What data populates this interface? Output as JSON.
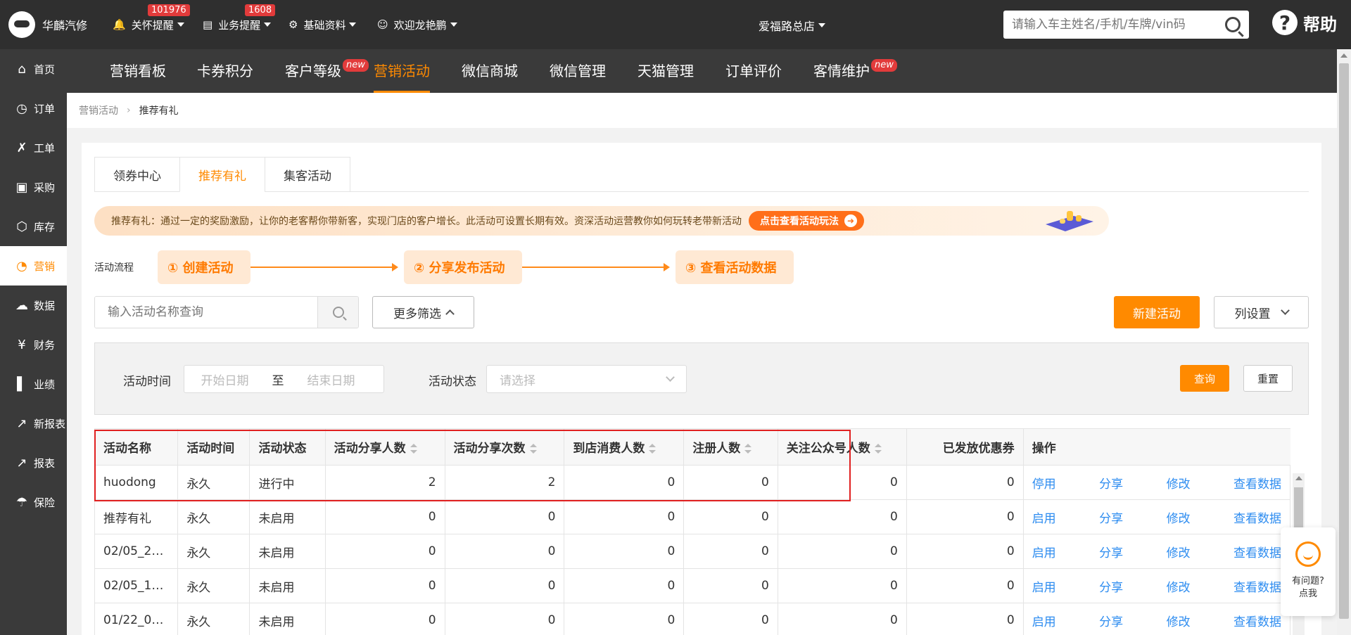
{
  "topbar": {
    "brand": "华麟汽修",
    "menus": [
      {
        "label": "关怀提醒",
        "badge": "101976",
        "icon": "bell-icon"
      },
      {
        "label": "业务提醒",
        "badge": "1608",
        "icon": "document-icon"
      },
      {
        "label": "基础资料",
        "icon": "gear-icon"
      },
      {
        "label": "欢迎龙艳鹏",
        "icon": "user-icon"
      }
    ],
    "store": "爱福路总店",
    "search_placeholder": "请输入车主姓名/手机/车牌/vin码",
    "help": "帮助"
  },
  "sidebar": {
    "items": [
      {
        "label": "首页",
        "icon": "home-icon"
      },
      {
        "label": "订单",
        "icon": "clock-icon"
      },
      {
        "label": "工单",
        "icon": "wrench-icon"
      },
      {
        "label": "采购",
        "icon": "cart-icon"
      },
      {
        "label": "库存",
        "icon": "box-icon"
      },
      {
        "label": "营销",
        "icon": "pie-icon"
      },
      {
        "label": "数据",
        "icon": "cloud-icon"
      },
      {
        "label": "财务",
        "icon": "yen-icon"
      },
      {
        "label": "业绩",
        "icon": "bar-chart-icon"
      },
      {
        "label": "新报表",
        "icon": "line-chart-icon"
      },
      {
        "label": "报表",
        "icon": "line-chart-icon"
      },
      {
        "label": "保险",
        "icon": "umbrella-icon"
      }
    ],
    "active_index": 5
  },
  "subnav": {
    "tabs": [
      {
        "label": "营销看板"
      },
      {
        "label": "卡券积分"
      },
      {
        "label": "客户等级",
        "badge": "new"
      },
      {
        "label": "营销活动"
      },
      {
        "label": "微信商城"
      },
      {
        "label": "微信管理"
      },
      {
        "label": "天猫管理"
      },
      {
        "label": "订单评价"
      },
      {
        "label": "客情维护",
        "badge": "new"
      }
    ],
    "active_index": 3
  },
  "breadcrumb": {
    "parent": "营销活动",
    "current": "推荐有礼"
  },
  "tabs": [
    "领券中心",
    "推荐有礼",
    "集客活动"
  ],
  "active_tab": 1,
  "banner": {
    "text": "推荐有礼：通过一定的奖励激励，让你的老客帮你带新客，实现门店的客户增长。此活动可设置长期有效。资深活动运营教你如何玩转老带新活动",
    "button": "点击查看活动玩法"
  },
  "flow": {
    "label": "活动流程",
    "steps": [
      "① 创建活动",
      "② 分享发布活动",
      "③ 查看活动数据"
    ]
  },
  "search": {
    "placeholder": "输入活动名称查询",
    "more_filter": "更多筛选",
    "new_button": "新建活动",
    "column_settings": "列设置"
  },
  "filters": {
    "time_label": "活动时间",
    "start_placeholder": "开始日期",
    "to": "至",
    "end_placeholder": "结束日期",
    "status_label": "活动状态",
    "status_placeholder": "请选择",
    "query": "查询",
    "reset": "重置"
  },
  "table": {
    "headers": [
      "活动名称",
      "活动时间",
      "活动状态",
      "活动分享人数",
      "活动分享次数",
      "到店消费人数",
      "注册人数",
      "关注公众号人数",
      "已发放优惠券",
      "操作"
    ],
    "rows": [
      {
        "name": "huodong",
        "time": "永久",
        "status": "进行中",
        "share_people": "2",
        "share_count": "2",
        "visit": "0",
        "register": "0",
        "follow": "0",
        "coupons": "0",
        "toggle": "停用"
      },
      {
        "name": "推荐有礼",
        "time": "永久",
        "status": "未启用",
        "share_people": "0",
        "share_count": "0",
        "visit": "0",
        "register": "0",
        "follow": "0",
        "coupons": "0",
        "toggle": "启用"
      },
      {
        "name": "02/05_20...",
        "time": "永久",
        "status": "未启用",
        "share_people": "0",
        "share_count": "0",
        "visit": "0",
        "register": "0",
        "follow": "0",
        "coupons": "0",
        "toggle": "启用"
      },
      {
        "name": "02/05_19...",
        "time": "永久",
        "status": "未启用",
        "share_people": "0",
        "share_count": "0",
        "visit": "0",
        "register": "0",
        "follow": "0",
        "coupons": "0",
        "toggle": "启用"
      },
      {
        "name": "01/22_08...",
        "time": "永久",
        "status": "未启用",
        "share_people": "0",
        "share_count": "0",
        "visit": "0",
        "register": "0",
        "follow": "0",
        "coupons": "0",
        "toggle": "启用"
      }
    ],
    "ops": {
      "share": "分享",
      "edit": "修改",
      "view": "查看数据"
    }
  },
  "help_widget": {
    "line1": "有问题?",
    "line2": "点我"
  },
  "colors": {
    "accent": "#ff8a00",
    "link": "#2d8cf0",
    "highlight_border": "#e02020",
    "topbar": "#2f2f2f"
  }
}
